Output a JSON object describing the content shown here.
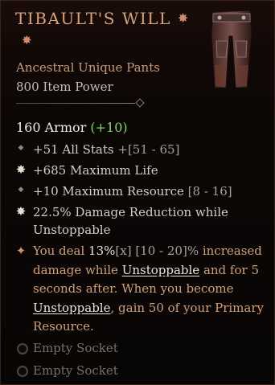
{
  "item": {
    "name": "TIBAULT'S WILL",
    "type": "Ancestral Unique Pants",
    "item_power": "800 Item Power"
  },
  "armor": {
    "base": "160 Armor",
    "bonus": "(+10)"
  },
  "stats": [
    {
      "text": "+51 All Stats",
      "range": "+[51 - 65]",
      "icon": "diamond-icon"
    },
    {
      "text": "+685 Maximum Life",
      "range": "",
      "icon": "star-icon"
    },
    {
      "text": "+10 Maximum Resource",
      "range": "[8 - 16]",
      "icon": "diamond-icon"
    },
    {
      "text": "22.5% Damage Reduction while",
      "text2": "Unstoppable",
      "icon": "star-icon"
    }
  ],
  "aspect": {
    "icon": "unique-rune-icon",
    "p1": "You deal ",
    "value": "13%",
    "x": "[x]",
    "range": " [10 - 20]%",
    "p2": " increased damage while ",
    "kw1": "Unstoppable",
    "p3": " and for 5 seconds after. When you become ",
    "kw2": "Unstoppable",
    "p4": ", gain 50 of your Primary Resource."
  },
  "sockets": [
    {
      "label": "Empty Socket"
    },
    {
      "label": "Empty Socket"
    }
  ],
  "colors": {
    "title": "#d7a37c",
    "bonus": "#7fd46a",
    "aspect": "#d2a070"
  }
}
